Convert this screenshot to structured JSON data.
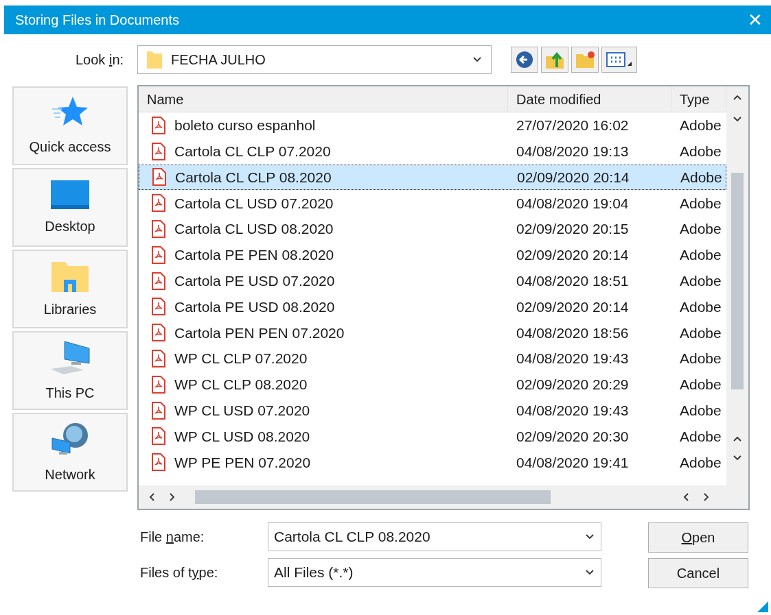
{
  "window": {
    "title": "Storing Files in Documents",
    "close": "✕"
  },
  "look_in": {
    "label": {
      "before": "Look ",
      "key": "i",
      "after": "n:"
    },
    "value": "FECHA JULHO"
  },
  "places": [
    {
      "label": "Quick access",
      "kind": "star"
    },
    {
      "label": "Desktop",
      "kind": "desktop"
    },
    {
      "label": "Libraries",
      "kind": "libraries"
    },
    {
      "label": "This PC",
      "kind": "pc"
    },
    {
      "label": "Network",
      "kind": "network"
    }
  ],
  "table": {
    "columns": [
      "Name",
      "Date modified",
      "Type"
    ],
    "rows": [
      {
        "name": "boleto curso espanhol",
        "date": "27/07/2020 16:02",
        "type": "Adobe",
        "selected": false
      },
      {
        "name": "Cartola CL CLP 07.2020",
        "date": "04/08/2020 19:13",
        "type": "Adobe",
        "selected": false
      },
      {
        "name": "Cartola CL CLP 08.2020",
        "date": "02/09/2020 20:14",
        "type": "Adobe",
        "selected": true
      },
      {
        "name": "Cartola CL USD 07.2020",
        "date": "04/08/2020 19:04",
        "type": "Adobe",
        "selected": false
      },
      {
        "name": "Cartola CL USD 08.2020",
        "date": "02/09/2020 20:15",
        "type": "Adobe",
        "selected": false
      },
      {
        "name": "Cartola PE PEN 08.2020",
        "date": "02/09/2020 20:14",
        "type": "Adobe",
        "selected": false
      },
      {
        "name": "Cartola PE USD 07.2020",
        "date": "04/08/2020 18:51",
        "type": "Adobe",
        "selected": false
      },
      {
        "name": "Cartola PE USD 08.2020",
        "date": "02/09/2020 20:14",
        "type": "Adobe",
        "selected": false
      },
      {
        "name": "Cartola PEN PEN 07.2020",
        "date": "04/08/2020 18:56",
        "type": "Adobe",
        "selected": false
      },
      {
        "name": "WP CL CLP 07.2020",
        "date": "04/08/2020 19:43",
        "type": "Adobe",
        "selected": false
      },
      {
        "name": "WP CL CLP 08.2020",
        "date": "02/09/2020 20:29",
        "type": "Adobe",
        "selected": false
      },
      {
        "name": "WP CL USD 07.2020",
        "date": "04/08/2020 19:43",
        "type": "Adobe",
        "selected": false
      },
      {
        "name": "WP CL USD 08.2020",
        "date": "02/09/2020 20:30",
        "type": "Adobe",
        "selected": false
      },
      {
        "name": "WP PE PEN 07.2020",
        "date": "04/08/2020 19:41",
        "type": "Adobe",
        "selected": false
      }
    ]
  },
  "file_name": {
    "label": {
      "before": "File ",
      "key": "n",
      "after": "ame:"
    },
    "value": "Cartola CL CLP 08.2020"
  },
  "file_type": {
    "label": {
      "before": "Files of t",
      "key": "y",
      "after": "pe:"
    },
    "value": "All Files (*.*)"
  },
  "buttons": [
    {
      "label": {
        "key": "O",
        "after": "pen"
      }
    },
    {
      "label": {
        "after": "Cancel"
      }
    }
  ]
}
